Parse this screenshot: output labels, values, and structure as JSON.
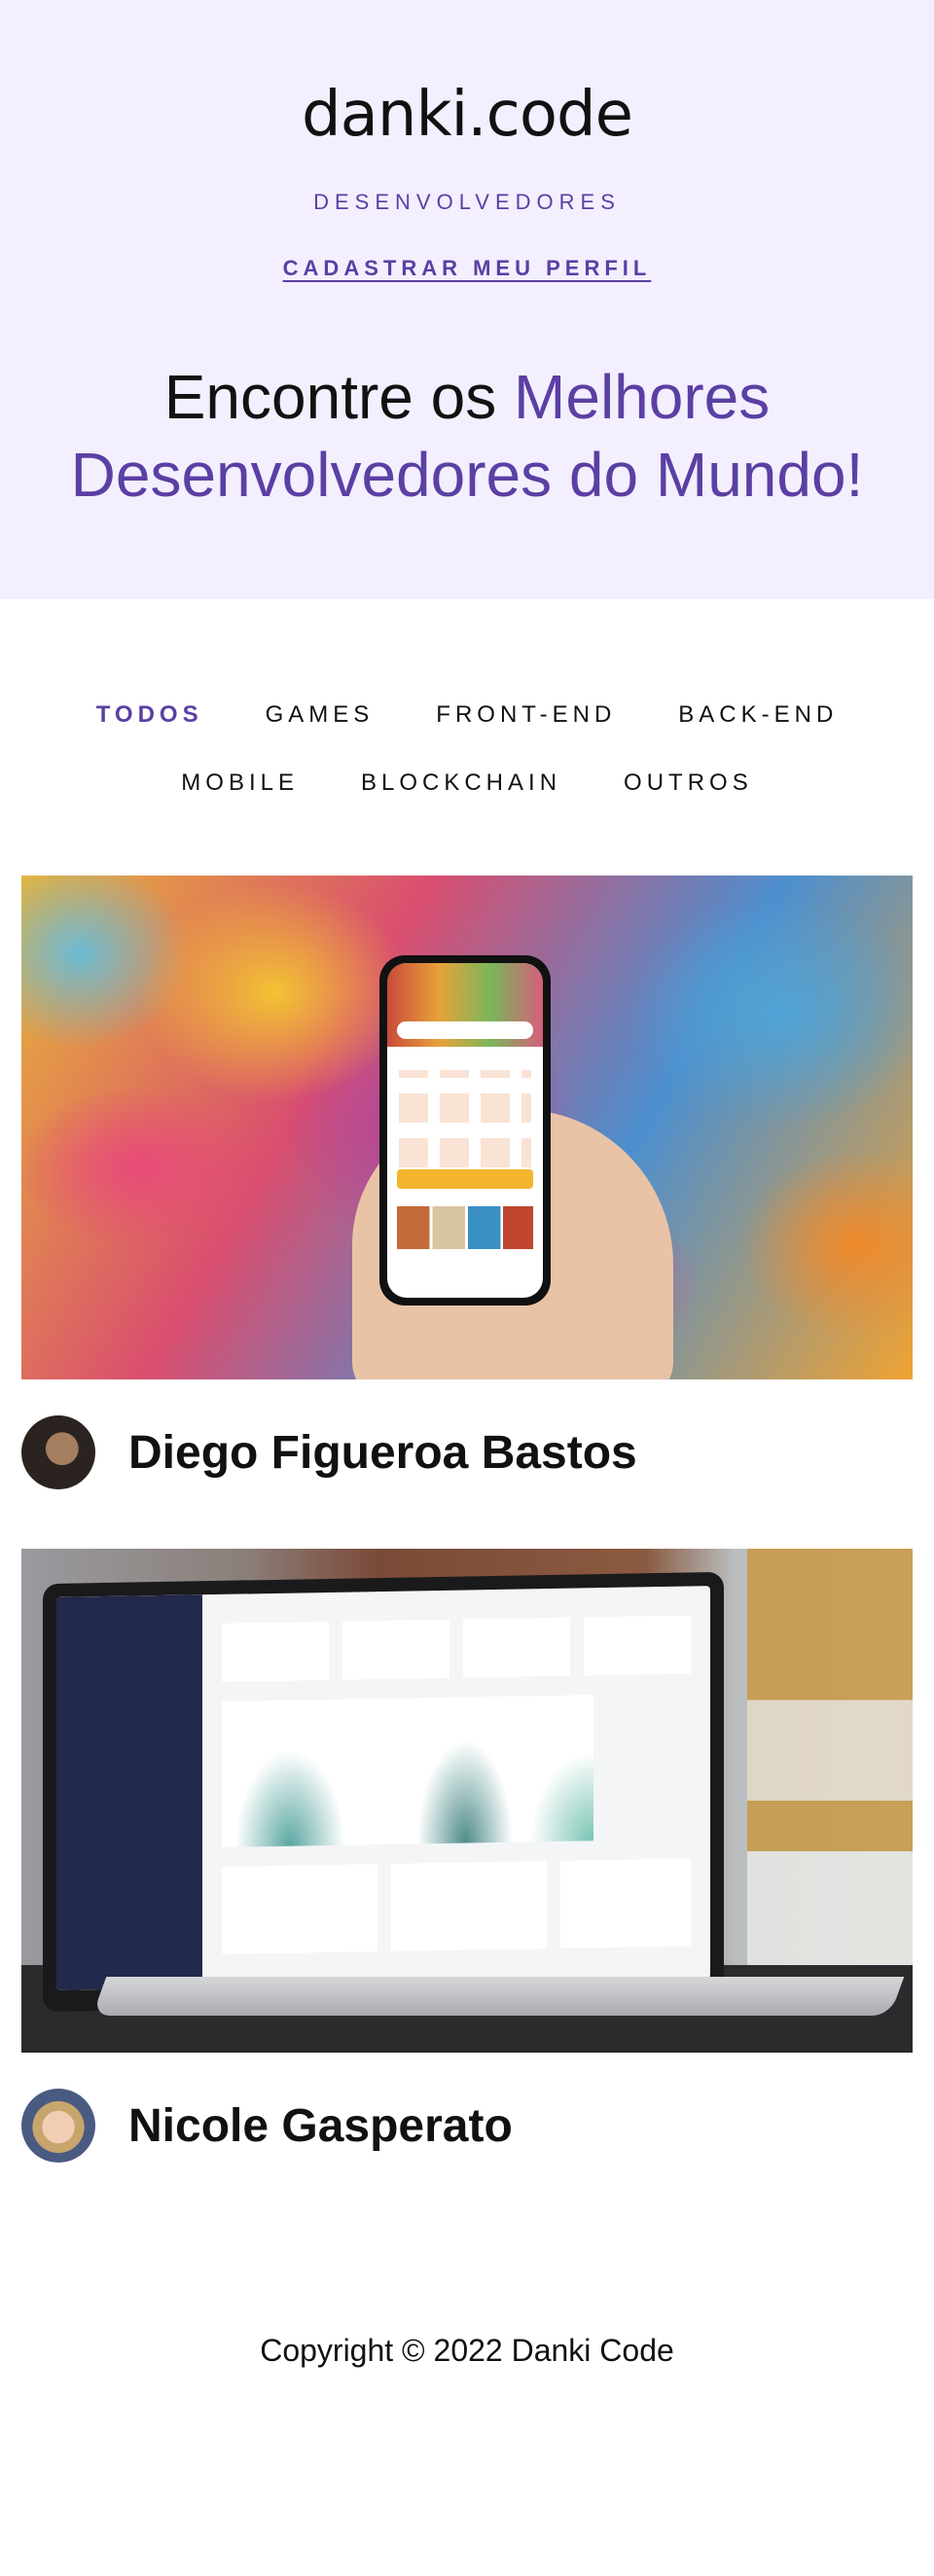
{
  "brand": {
    "logo": "danki.code",
    "subtitle": "DESENVOLVEDORES",
    "cta_label": "CADASTRAR MEU PERFIL"
  },
  "hero": {
    "headline_part1": "Encontre os ",
    "headline_accent": "Melhores Desenvolvedores do Mundo!"
  },
  "filters": {
    "row1": [
      "TODOS",
      "GAMES",
      "FRONT-END",
      "BACK-END"
    ],
    "row2": [
      "MOBILE",
      "BLOCKCHAIN",
      "OUTROS"
    ],
    "active": "TODOS"
  },
  "developers": [
    {
      "name": "Diego Figueroa Bastos",
      "image": "phone-app-graffiti",
      "avatar": "avatar-diego"
    },
    {
      "name": "Nicole Gasperato",
      "image": "laptop-dashboard",
      "avatar": "avatar-nicole"
    }
  ],
  "footer": {
    "copyright": "Copyright © 2022  Danki Code"
  },
  "colors": {
    "accent": "#5b3fa3",
    "hero_bg": "#f3efff",
    "text": "#111111"
  }
}
